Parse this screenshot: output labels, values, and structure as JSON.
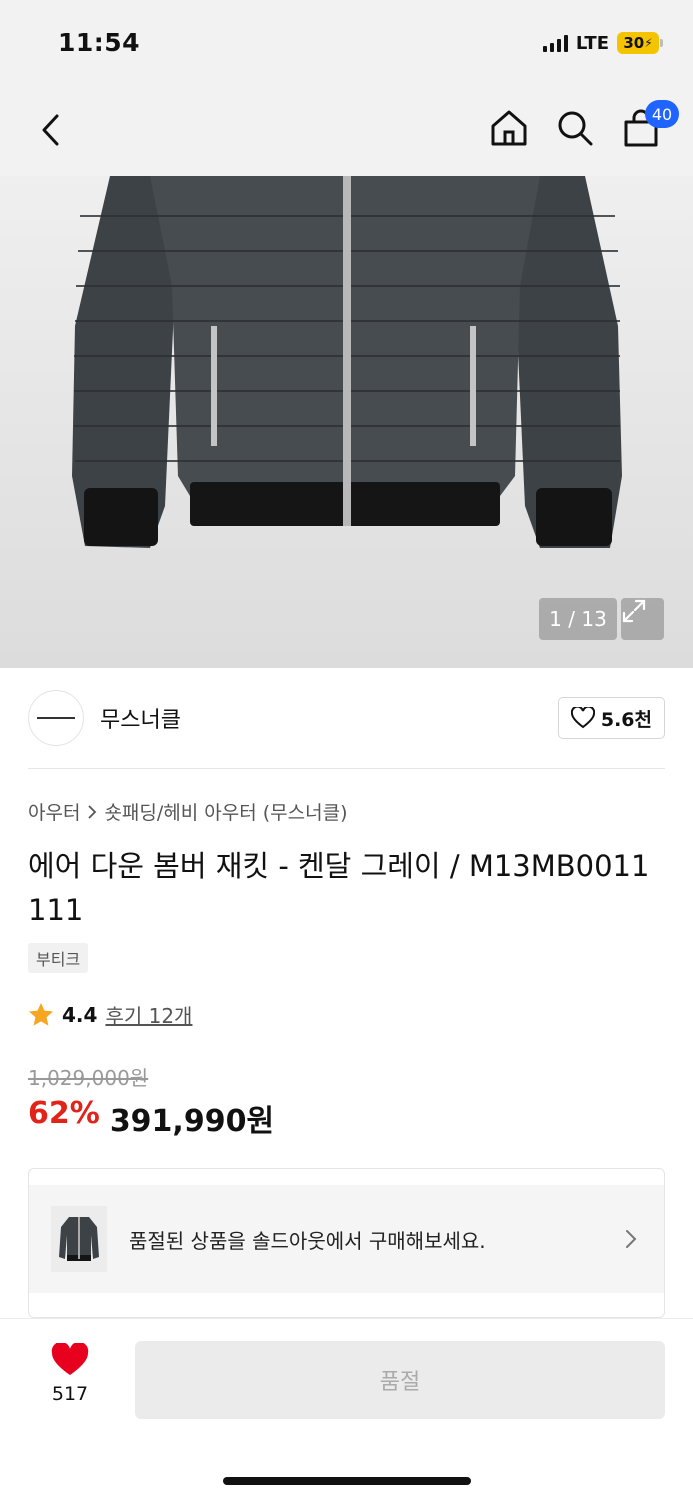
{
  "status": {
    "time": "11:54",
    "network": "LTE",
    "battery": "30"
  },
  "nav": {
    "cart_count": "40"
  },
  "gallery": {
    "counter": "1 / 13"
  },
  "brand": {
    "name": "무스너클",
    "likes": "5.6천"
  },
  "breadcrumb": {
    "first": "아우터",
    "second": "숏패딩/헤비 아우터 (무스너클)"
  },
  "product": {
    "title": "에어 다운 봄버 재킷 - 켄달 그레이 / M13MB0011 111",
    "tag": "부티크",
    "rating": "4.4",
    "reviews": "후기 12개",
    "original_price": "1,029,000원",
    "discount": "62%",
    "price": "391,990원"
  },
  "soldout": {
    "message": "품절된 상품을 솔드아웃에서 구매해보세요."
  },
  "bottom": {
    "wish_count": "517",
    "buy_label": "품절"
  },
  "colors": {
    "accent_blue": "#1f64ff",
    "discount_red": "#e2231a",
    "star": "#f5a623",
    "heart": "#e8001f"
  }
}
